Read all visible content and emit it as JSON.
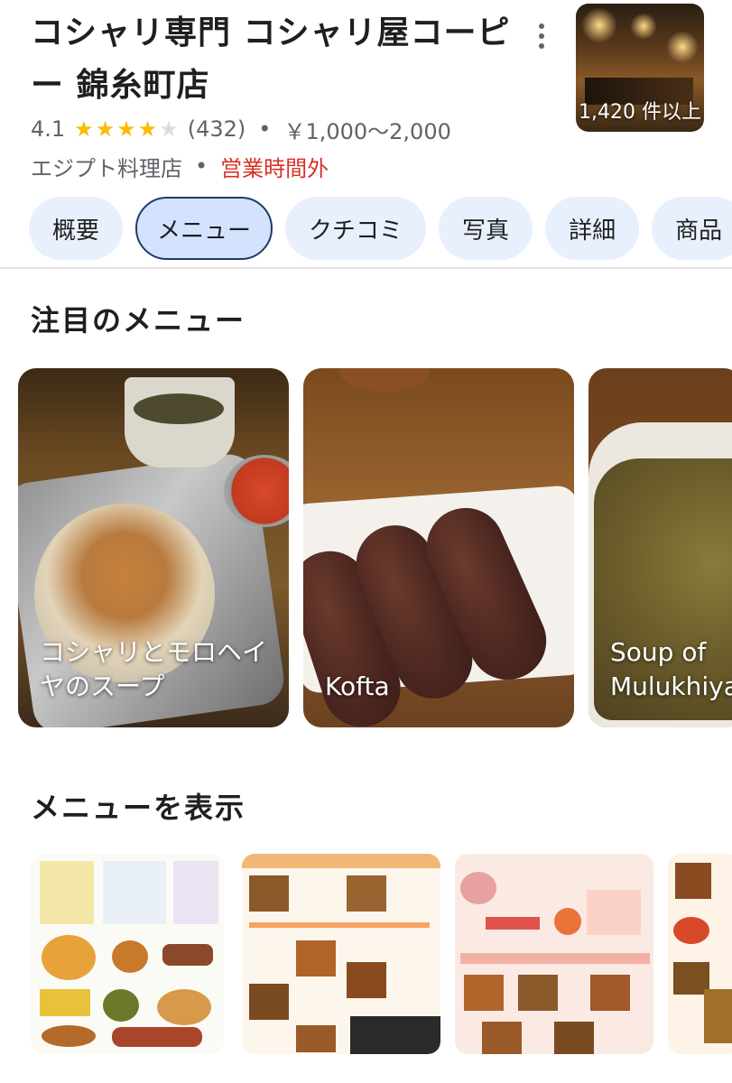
{
  "place": {
    "title": "コシャリ専門 コシャリ屋コーピー 錦糸町店",
    "rating": "4.1",
    "stars_filled": 4,
    "review_count": "(432)",
    "price_range": "￥1,000〜2,000",
    "category": "エジプト料理店",
    "status": "営業時間外",
    "photo_count": "1,420 件以上"
  },
  "tabs": [
    {
      "label": "概要"
    },
    {
      "label": "メニュー",
      "active": true
    },
    {
      "label": "クチコミ"
    },
    {
      "label": "写真"
    },
    {
      "label": "詳細"
    },
    {
      "label": "商品"
    }
  ],
  "featured": {
    "title": "注目のメニュー",
    "items": [
      {
        "label": "コシャリとモロヘイヤのスープ"
      },
      {
        "label": "Kofta"
      },
      {
        "label": "Soup of Mulukhiya"
      }
    ]
  },
  "menu_section": {
    "title": "メニューを表示"
  },
  "colors": {
    "star": "#fbbc04",
    "closed": "#d93025",
    "tab_bg": "#e8f0fe",
    "tab_active_border": "#1f3a66"
  },
  "icons": {
    "more": "more-vert-icon"
  }
}
